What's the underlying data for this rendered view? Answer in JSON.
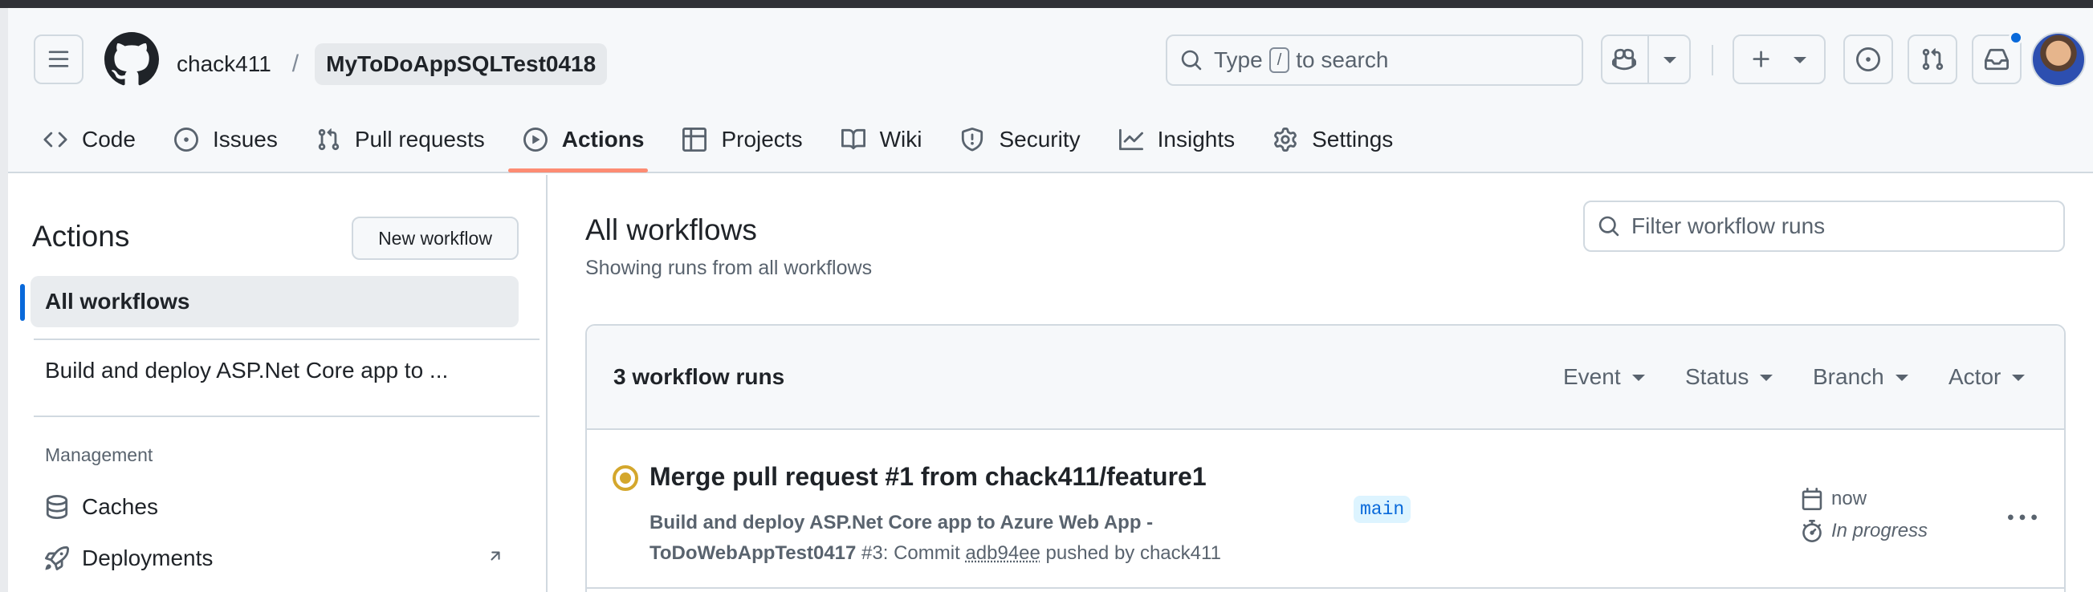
{
  "header": {
    "owner": "chack411",
    "separator": "/",
    "repo": "MyToDoAppSQLTest0418",
    "search": {
      "prefix": "Type",
      "key": "/",
      "suffix": "to search"
    },
    "icons": [
      "hamburger-icon",
      "github-logo-icon",
      "copilot-icon",
      "plus-icon",
      "issue-icon",
      "pull-request-icon",
      "inbox-icon"
    ],
    "notification_color": "#0969da"
  },
  "repo_nav": {
    "tabs": [
      {
        "label": "Code",
        "icon": "code-icon"
      },
      {
        "label": "Issues",
        "icon": "issue-icon"
      },
      {
        "label": "Pull requests",
        "icon": "pull-request-icon"
      },
      {
        "label": "Actions",
        "icon": "play-icon",
        "selected": true
      },
      {
        "label": "Projects",
        "icon": "table-icon"
      },
      {
        "label": "Wiki",
        "icon": "book-icon"
      },
      {
        "label": "Security",
        "icon": "shield-icon"
      },
      {
        "label": "Insights",
        "icon": "graph-icon"
      },
      {
        "label": "Settings",
        "icon": "gear-icon"
      }
    ],
    "selected_underline_color": "#fd8c73"
  },
  "sidebar": {
    "title": "Actions",
    "new_workflow": "New workflow",
    "all_workflows": "All workflows",
    "workflow_item": "Build and deploy ASP.Net Core app to ...",
    "management_heading": "Management",
    "caches": "Caches",
    "deployments": "Deployments"
  },
  "main": {
    "title": "All workflows",
    "subtitle": "Showing runs from all workflows",
    "filter_placeholder": "Filter workflow runs",
    "runs_count": "3 workflow runs",
    "filters": [
      "Event",
      "Status",
      "Branch",
      "Actor"
    ],
    "runs": [
      {
        "title": "Merge pull request #1 from chack411/feature1",
        "workflow_line1": "Build and deploy ASP.Net Core app to Azure Web App -",
        "workflow_line2": "ToDoWebAppTest0417",
        "run_number": "#3: Commit",
        "sha": "adb94ee",
        "pushed_by": "pushed by chack411",
        "branch": "main",
        "when": "now",
        "duration": "In progress",
        "status_color": "#d4a72c"
      }
    ]
  }
}
